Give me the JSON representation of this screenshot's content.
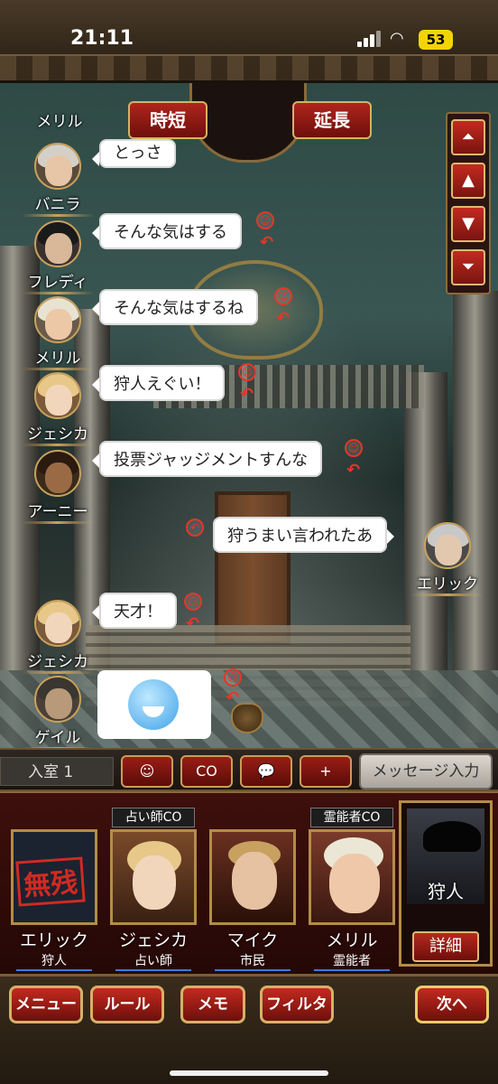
{
  "status_bar": {
    "time": "21:11",
    "battery": "53"
  },
  "top_buttons": {
    "shorten": "時短",
    "extend": "延長"
  },
  "scroll_buttons": [
    "top",
    "up",
    "down",
    "bottom"
  ],
  "chat": [
    {
      "speaker": "メリル",
      "text": ""
    },
    {
      "speaker": "バニラ",
      "text": "とっさ"
    },
    {
      "speaker": "フレディ",
      "text": "そんな気はする"
    },
    {
      "speaker": "メリル",
      "text": "そんな気はするね"
    },
    {
      "speaker": "ジェシカ",
      "text": "狩人えぐい！"
    },
    {
      "speaker": "アーニー",
      "text": "投票ジャッジメントすんな"
    },
    {
      "speaker": "エリック",
      "text": "狩うまい言われたあ"
    },
    {
      "speaker": "ジェシカ",
      "text": "天才！"
    },
    {
      "speaker": "ゲイル",
      "text": ""
    }
  ],
  "stamp": "smiling-face-with-hands-stamp",
  "action_bar": {
    "room": "入室 1",
    "buttons": [
      "☺",
      "CO",
      "💬",
      "+"
    ],
    "co_label": "CO",
    "message_input": "メッセージ入力"
  },
  "players": [
    {
      "tag": "",
      "name": "エリック",
      "role": "狩人",
      "status": "無残"
    },
    {
      "tag": "占い師CO",
      "name": "ジェシカ",
      "role": "占い師",
      "status": ""
    },
    {
      "tag": "",
      "name": "マイク",
      "role": "市民",
      "status": ""
    },
    {
      "tag": "霊能者CO",
      "name": "メリル",
      "role": "霊能者",
      "status": ""
    }
  ],
  "self": {
    "role": "狩人",
    "detail_button": "詳細"
  },
  "bottom_nav": {
    "menu": "メニュー",
    "rule": "ルール",
    "memo": "メモ",
    "filter": "フィルタ",
    "next": "次へ"
  },
  "colors": {
    "accent_red": "#b0251d",
    "gold": "#d6b067",
    "role_underline": "#3b7bd6"
  }
}
